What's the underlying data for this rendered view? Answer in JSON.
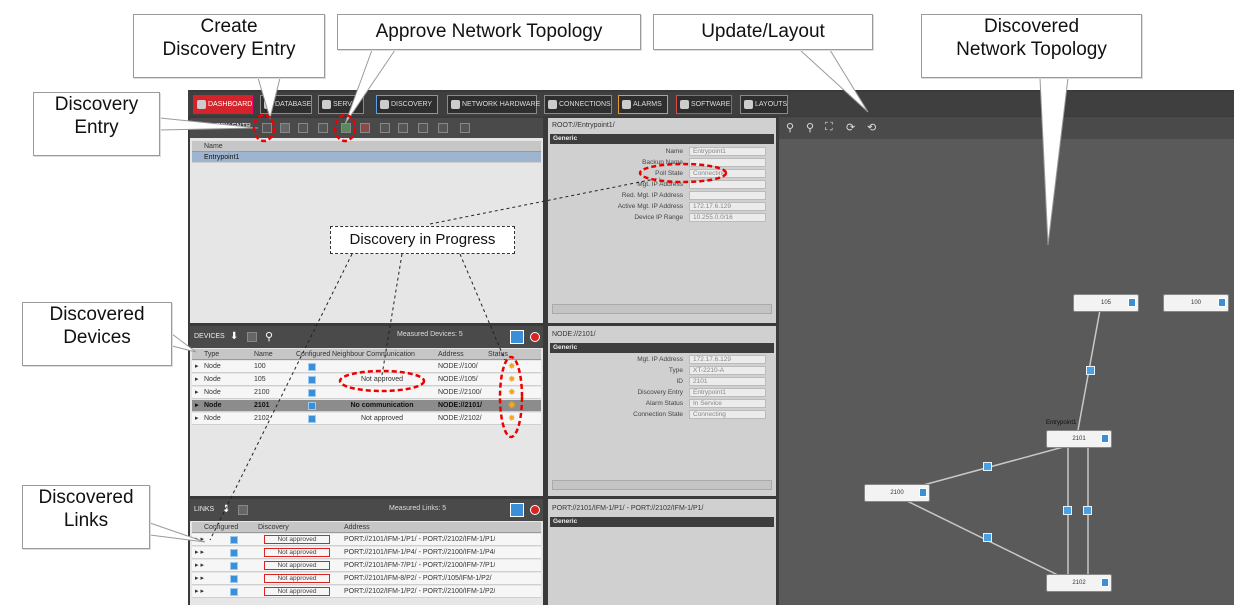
{
  "callouts": {
    "create_entry": "Create\nDiscovery Entry",
    "approve": "Approve Network Topology",
    "update_layout": "Update/Layout",
    "discovered_topology": "Discovered\nNetwork Topology",
    "discovery_entry": "Discovery\nEntry",
    "discovered_devices": "Discovered\nDevices",
    "discovered_links": "Discovered\nLinks",
    "in_progress": "Discovery in Progress"
  },
  "menu": {
    "tabs": [
      {
        "label": "DASHBOARD"
      },
      {
        "label": "DATABASE"
      },
      {
        "label": "SERVI"
      },
      {
        "label": "DISCOVERY"
      },
      {
        "label": "NETWORK HARDWARE"
      },
      {
        "label": "CONNECTIONS"
      },
      {
        "label": "ALARMS"
      },
      {
        "label": "SOFTWARE"
      },
      {
        "label": "LAYOUTS"
      }
    ]
  },
  "discovery_entry": {
    "title": "ISCOVERY ENTR",
    "column": "Name",
    "rows": [
      "Entrypoint1"
    ]
  },
  "devices": {
    "title": "DEVICES",
    "measured": "Measured Devices: 5",
    "columns": [
      "Type",
      "Name",
      "Configured",
      "Neighbour Communication",
      "Address",
      "Status"
    ],
    "rows": [
      {
        "type": "Node",
        "name": "100",
        "comm": "",
        "address": "NODE://100/"
      },
      {
        "type": "Node",
        "name": "105",
        "comm": "Not approved",
        "address": "NODE://105/"
      },
      {
        "type": "Node",
        "name": "2100",
        "comm": "",
        "address": "NODE://2100/"
      },
      {
        "type": "Node",
        "name": "2101",
        "comm": "No communication",
        "address": "NODE://2101/"
      },
      {
        "type": "Node",
        "name": "2102",
        "comm": "Not approved",
        "address": "NODE://2102/"
      }
    ]
  },
  "links": {
    "title": "LINKS",
    "measured": "Measured Links: 5",
    "columns": [
      "Configured",
      "Discovery",
      "Address"
    ],
    "rows": [
      {
        "discovery": "Not approved",
        "address": "PORT://2101/IFM-1/P1/ - PORT://2102/IFM-1/P1/"
      },
      {
        "discovery": "Not approved",
        "address": "PORT://2101/IFM-1/P4/ - PORT://2100/IFM-1/P4/"
      },
      {
        "discovery": "Not approved",
        "address": "PORT://2101/IFM-7/P1/ - PORT://2100/IFM-7/P1/"
      },
      {
        "discovery": "Not approved",
        "address": "PORT://2101/IFM-8/P2/ - PORT://105/IFM-1/P2/"
      },
      {
        "discovery": "Not approved",
        "address": "PORT://2102/IFM-1/P2/ - PORT://2100/IFM-1/P2/"
      }
    ]
  },
  "root_props": {
    "path": "ROOT://Entrypoint1/",
    "section": "Generic",
    "fields": [
      {
        "label": "Name",
        "value": "Entrypoint1"
      },
      {
        "label": "Backup Name",
        "value": ""
      },
      {
        "label": "Poll State",
        "value": "Connecting"
      },
      {
        "label": "Mgt. IP Address",
        "value": ""
      },
      {
        "label": "Red. Mgt. IP Address",
        "value": ""
      },
      {
        "label": "Active Mgt. IP Address",
        "value": "172.17.6.129"
      },
      {
        "label": "Device IP Range",
        "value": "10.255.0.0/16"
      }
    ]
  },
  "node_props": {
    "path": "NODE://2101/",
    "section": "Generic",
    "fields": [
      {
        "label": "Mgt. IP Address",
        "value": "172.17.6.129"
      },
      {
        "label": "Type",
        "value": "XT-2210-A"
      },
      {
        "label": "ID",
        "value": "2101"
      },
      {
        "label": "Discovery Entry",
        "value": "Entrypoint1"
      },
      {
        "label": "Alarm Status",
        "value": "In Service"
      },
      {
        "label": "Connection State",
        "value": "Connecting"
      }
    ]
  },
  "port_props": {
    "path": "PORT://2101/IFM-1/P1/ - PORT://2102/IFM-1/P1/",
    "section": "Generic"
  },
  "topology": {
    "nodes": [
      {
        "label": "105"
      },
      {
        "label": "100"
      },
      {
        "label": "2101"
      },
      {
        "label": "2100"
      },
      {
        "label": "2102"
      }
    ],
    "entry_label": "Entrypoint1"
  },
  "colors": {
    "accent_red": "#d5232b",
    "link_blue": "#3b8fd9",
    "status_star": "#f2a623"
  }
}
